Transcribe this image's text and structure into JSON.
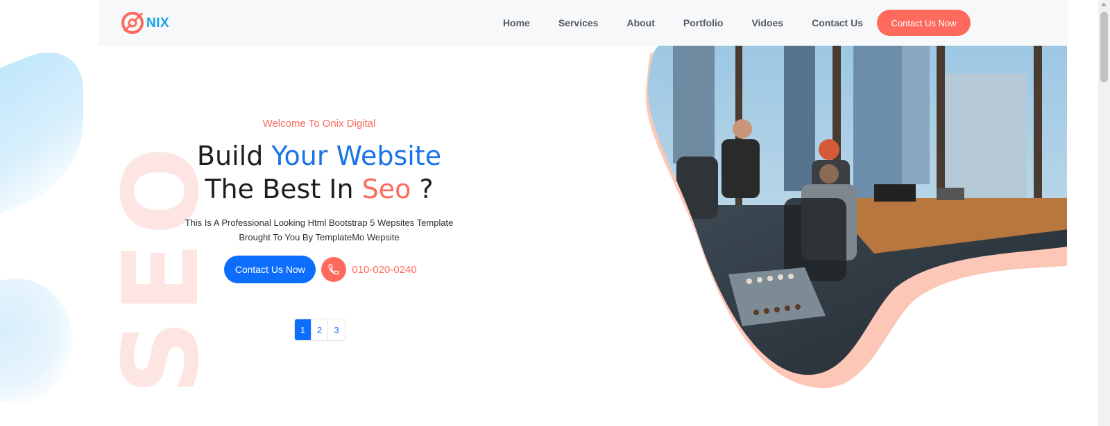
{
  "brand": {
    "logo_text": "NIX",
    "primary_color": "#fe6a5d",
    "accent_color": "#1aa3e8"
  },
  "nav": {
    "items": [
      {
        "label": "Home"
      },
      {
        "label": "Services"
      },
      {
        "label": "About"
      },
      {
        "label": "Portfolio"
      },
      {
        "label": "Vidoes"
      },
      {
        "label": "Contact Us"
      }
    ],
    "cta_label": "Contact Us Now"
  },
  "hero": {
    "watermark": "SEO",
    "welcome": "Welcome To Onix Digital",
    "heading": {
      "line1_part1": "Build ",
      "line1_highlight": "Your Website",
      "line2_part1": "The Best In ",
      "line2_highlight": "Seo",
      "line2_part2": " ?"
    },
    "description_line1": "This Is A Professional Looking Html Bootstrap 5 Wepsites Template",
    "description_line2": "Brought To You By TemplateMo Wepsite",
    "cta_label": "Contact Us Now",
    "phone": "010-020-0240",
    "phone_icon": "phone-icon",
    "image_subject": "office-team-photo"
  },
  "pagination": {
    "pages": [
      "1",
      "2",
      "3"
    ],
    "active_index": 0
  },
  "colors": {
    "blue_button": "#0d6efd",
    "heading_highlight_blue": "#1a73e8",
    "watermark": "#fde3e1",
    "header_bg": "#f7f8fa"
  }
}
